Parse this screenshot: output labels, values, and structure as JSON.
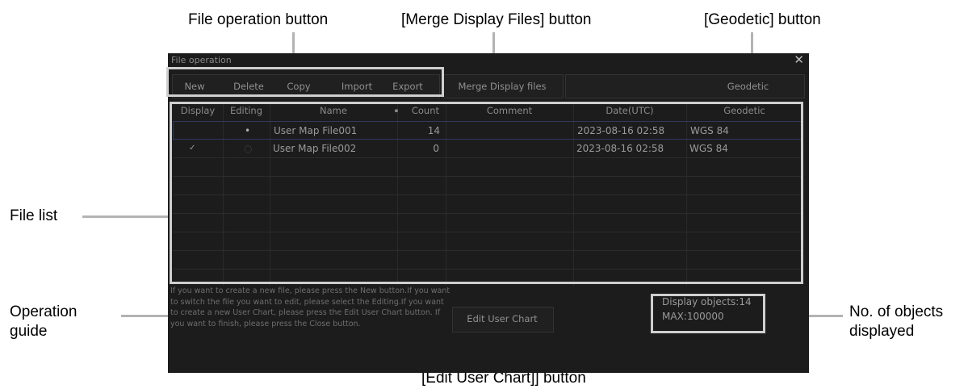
{
  "annotations": {
    "file_operation": "File operation button",
    "merge": "[Merge Display Files] button",
    "geodetic": "[Geodetic] button",
    "file_list": "File list",
    "operation_guide_line1": "Operation",
    "operation_guide_line2": "guide",
    "objects_line1": "No. of objects",
    "objects_line2": "displayed",
    "edit_user_chart": "[Edit User Chart]] button"
  },
  "window": {
    "title": "File operation",
    "close": "✕"
  },
  "toolbar": {
    "new": "New",
    "delete": "Delete",
    "copy": "Copy",
    "import": "Import",
    "export": "Export",
    "merge": "Merge Display files",
    "geodetic": "Geodetic"
  },
  "table": {
    "headers": {
      "display": "Display",
      "editing": "Editing",
      "name": "Name",
      "sort_indicator": "▪",
      "count": "Count",
      "comment": "Comment",
      "date": "Date(UTC)",
      "geodetic": "Geodetic"
    },
    "rows": [
      {
        "display": "",
        "editing": "•",
        "name": "User Map File001",
        "count": "14",
        "comment": "",
        "date": "2023-08-16 02:58",
        "geodetic": "WGS 84"
      },
      {
        "display": "✓",
        "editing": "○",
        "name": "User Map File002",
        "count": "0",
        "comment": "",
        "date": "2023-08-16 02:58",
        "geodetic": "WGS 84"
      }
    ]
  },
  "guide_text": "If you want to create a new file, please press the New button.If you want to switch the file you want to edit, please select the Editing.If you want to create a new User Chart, please press the Edit User Chart button. If you want to finish, please press the Close button.",
  "edit_user_chart": "Edit User Chart",
  "objects": {
    "display": "Display objects:14",
    "max": "MAX:100000"
  },
  "colors": {
    "window_bg": "#1c1c1c",
    "highlight_border": "#cfcfcf",
    "selected_row": "#2d3a5a"
  }
}
